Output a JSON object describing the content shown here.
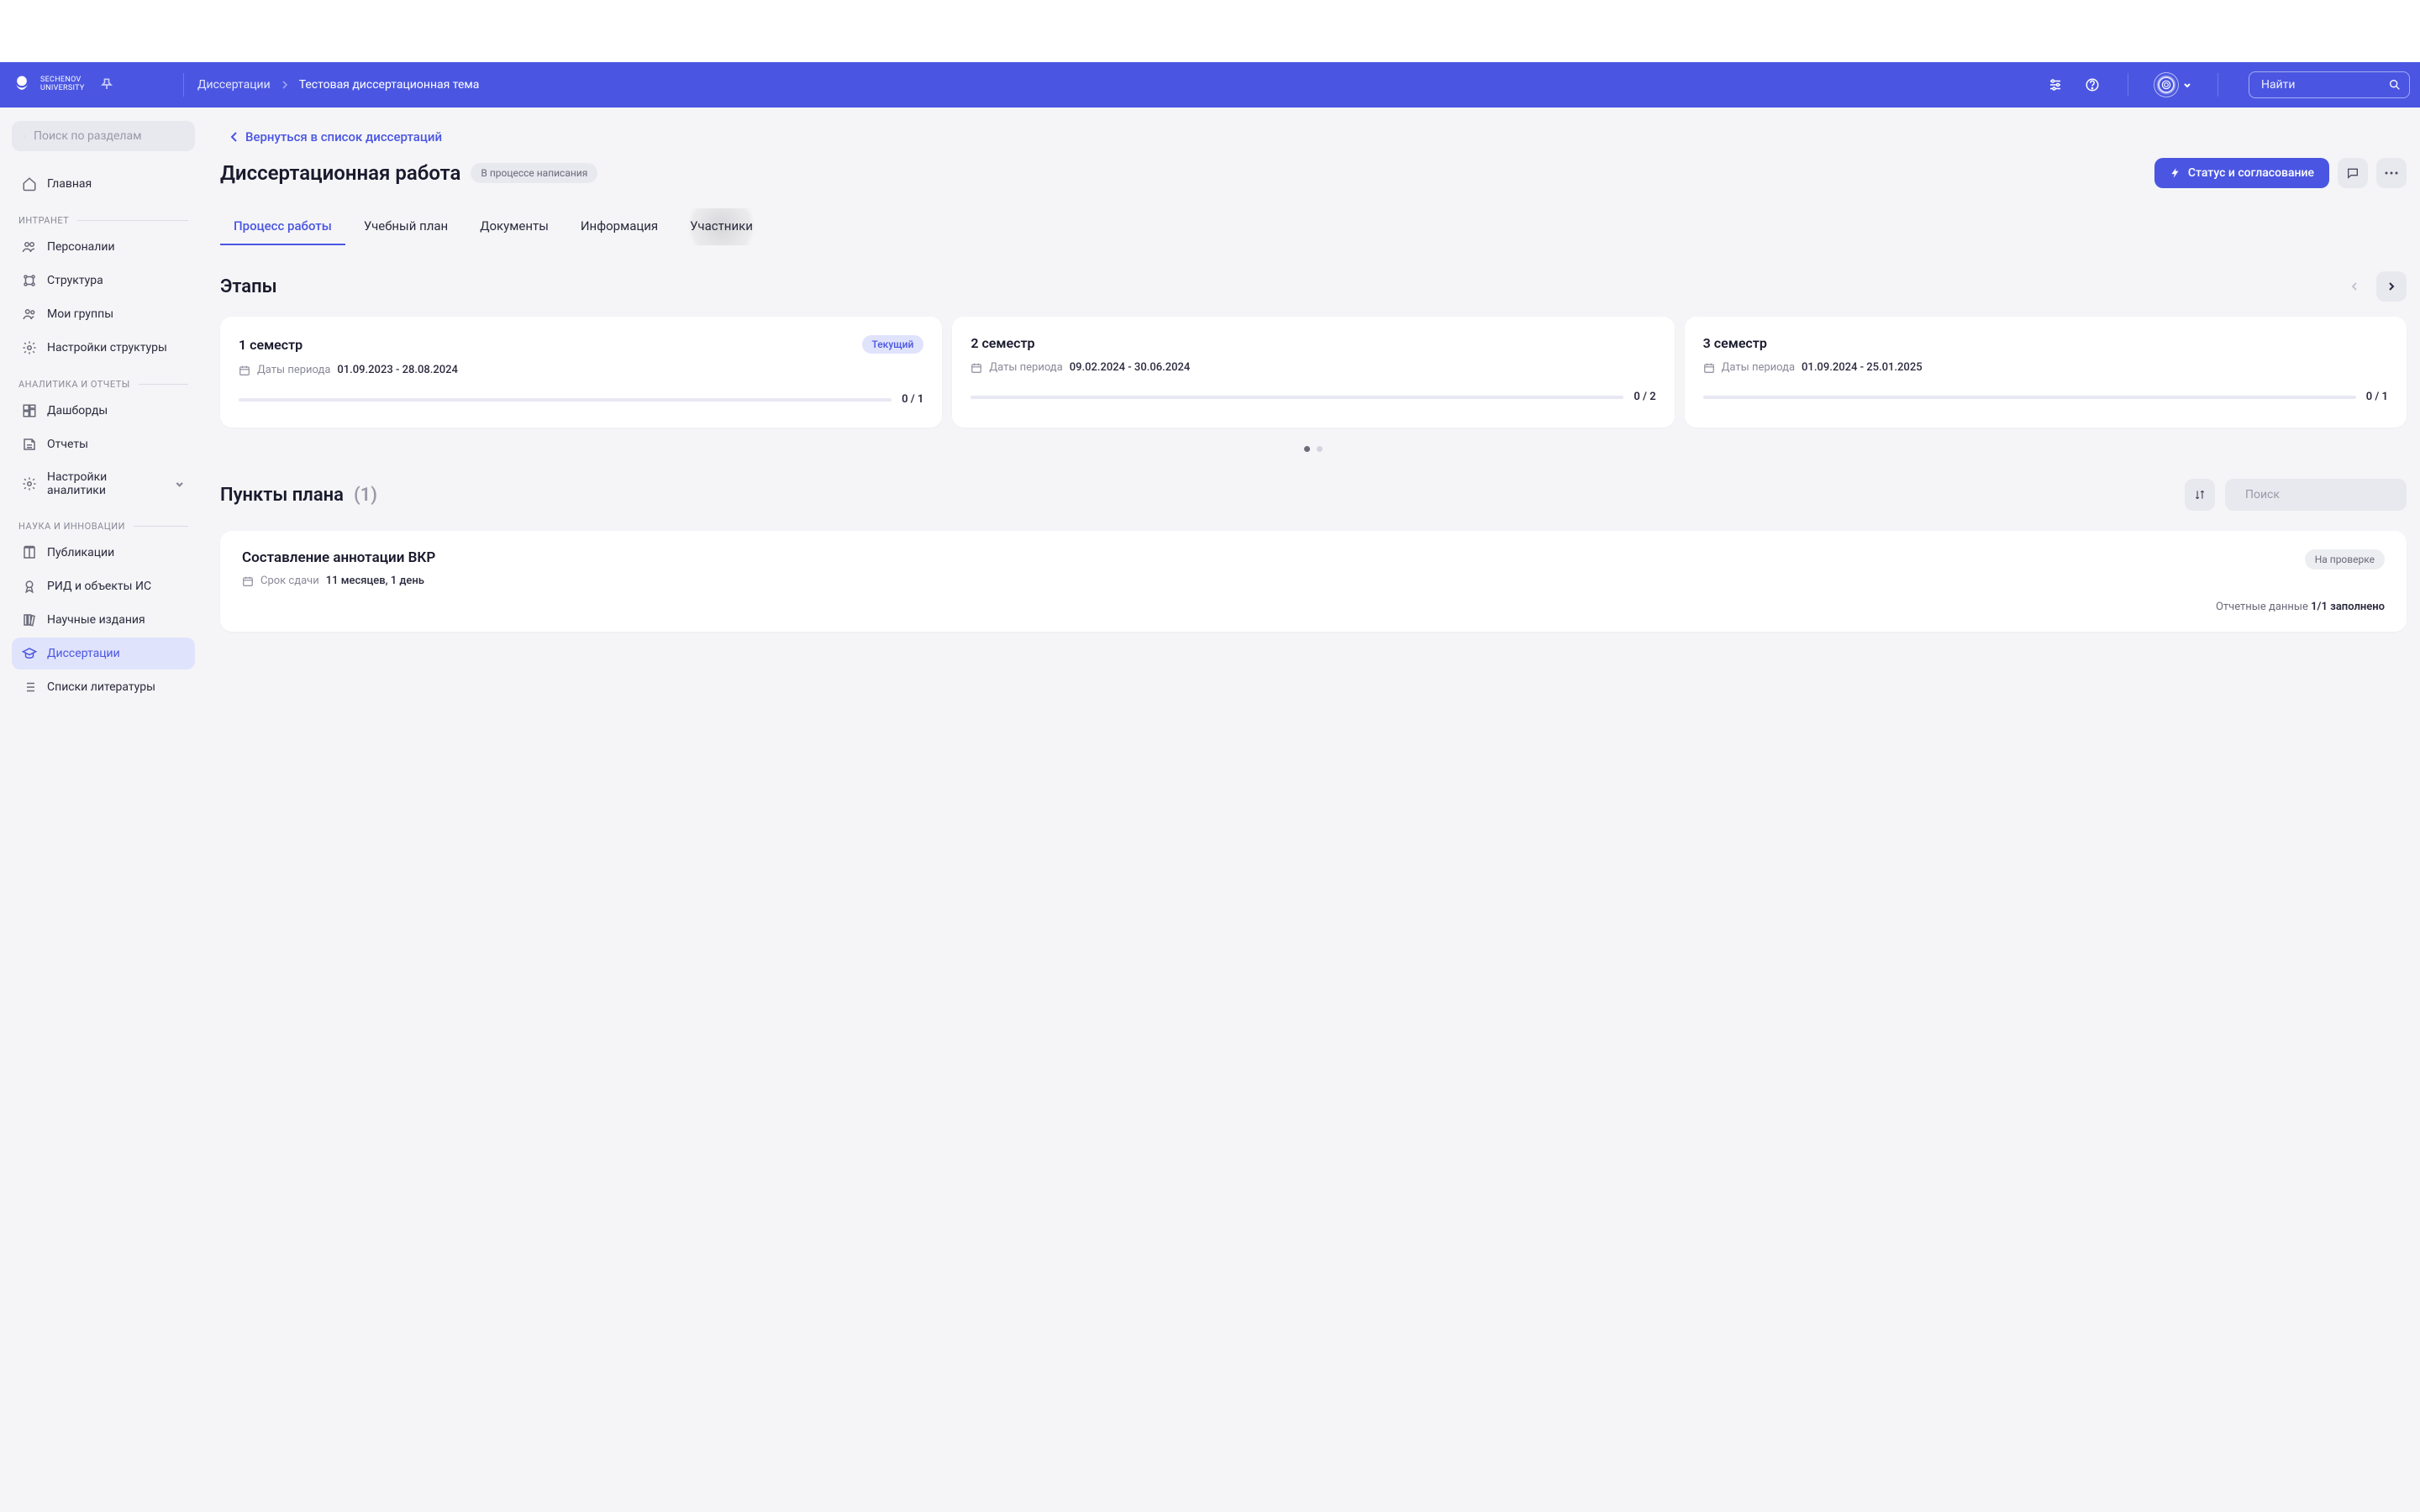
{
  "brand": {
    "line1": "Sechenov",
    "line2": "University"
  },
  "breadcrumb": {
    "root": "Диссертации",
    "current": "Тестовая диссертационная тема"
  },
  "search": {
    "placeholder": "Найти"
  },
  "sidebar": {
    "search_placeholder": "Поиск по разделам",
    "home": "Главная",
    "sections": [
      {
        "label": "ИНТРАНЕТ",
        "items": [
          {
            "name": "Персоналии",
            "icon": "people"
          },
          {
            "name": "Структура",
            "icon": "org"
          },
          {
            "name": "Мои группы",
            "icon": "group"
          },
          {
            "name": "Настройки структуры",
            "icon": "gear"
          }
        ]
      },
      {
        "label": "АНАЛИТИКА И ОТЧЕТЫ",
        "items": [
          {
            "name": "Дашборды",
            "icon": "dashboard"
          },
          {
            "name": "Отчеты",
            "icon": "report"
          },
          {
            "name": "Настройки аналитики",
            "icon": "gear",
            "expandable": true
          }
        ]
      },
      {
        "label": "НАУКА И ИННОВАЦИИ",
        "items": [
          {
            "name": "Публикации",
            "icon": "book"
          },
          {
            "name": "РИД и объекты ИС",
            "icon": "medal"
          },
          {
            "name": "Научные издания",
            "icon": "library"
          },
          {
            "name": "Диссертации",
            "icon": "grad",
            "active": true
          },
          {
            "name": "Списки литературы",
            "icon": "list"
          }
        ]
      }
    ]
  },
  "page": {
    "back": "Вернуться в список диссертаций",
    "title": "Диссертационная работа",
    "status_chip": "В процессе написания",
    "btn_status": "Статус и согласование"
  },
  "tabs": [
    {
      "label": "Процесс работы",
      "active": true
    },
    {
      "label": "Учебный план"
    },
    {
      "label": "Документы"
    },
    {
      "label": "Информация"
    },
    {
      "label": "Участники",
      "hover": true
    }
  ],
  "stages": {
    "title": "Этапы",
    "dates_label": "Даты периода",
    "cards": [
      {
        "name": "1 семестр",
        "badge": "Текущий",
        "dates": "01.09.2023 - 28.08.2024",
        "done": "0",
        "total": "1"
      },
      {
        "name": "2 семестр",
        "dates": "09.02.2024 - 30.06.2024",
        "done": "0",
        "total": "2"
      },
      {
        "name": "3 семестр",
        "dates": "01.09.2024 - 25.01.2025",
        "done": "0",
        "total": "1"
      }
    ]
  },
  "plan": {
    "title": "Пункты плана",
    "count": "(1)",
    "search_placeholder": "Поиск",
    "item": {
      "title": "Составление аннотации ВКР",
      "deadline_label": "Срок сдачи",
      "deadline_value": "11 месяцев, 1 день",
      "badge": "На проверке",
      "report_label": "Отчетные данные",
      "report_value": "1/1 заполнено"
    }
  }
}
